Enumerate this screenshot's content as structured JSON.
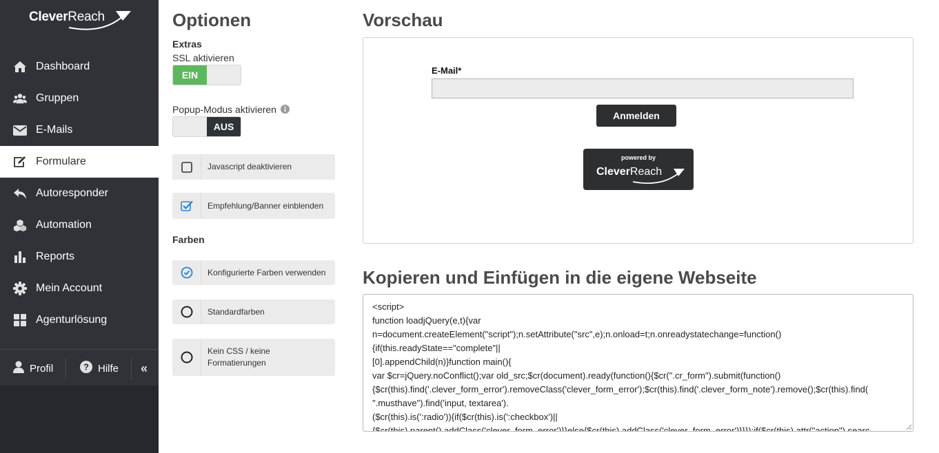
{
  "sidebar": {
    "logo": "CleverReach",
    "logo_bold": "Clever",
    "logo_thin": "Reach",
    "items": [
      {
        "label": "Dashboard",
        "icon": "home-icon"
      },
      {
        "label": "Gruppen",
        "icon": "users-icon"
      },
      {
        "label": "E-Mails",
        "icon": "envelope-icon"
      },
      {
        "label": "Formulare",
        "icon": "edit-icon",
        "active": true
      },
      {
        "label": "Autoresponder",
        "icon": "reply-icon"
      },
      {
        "label": "Automation",
        "icon": "cubes-icon"
      },
      {
        "label": "Reports",
        "icon": "bar-chart-icon"
      },
      {
        "label": "Mein Account",
        "icon": "gear-icon"
      },
      {
        "label": "Agenturlösung",
        "icon": "grid-icon"
      }
    ],
    "profile_label": "Profil",
    "help_label": "Hilfe",
    "collapse_glyph": "«"
  },
  "options": {
    "title": "Optionen",
    "extras_heading": "Extras",
    "ssl_label": "SSL aktivieren",
    "ssl_toggle": {
      "on_label": "EIN",
      "state": "on"
    },
    "popup_label": "Popup-Modus aktivieren",
    "popup_toggle": {
      "off_label": "AUS",
      "state": "off"
    },
    "checkboxes": [
      {
        "label": "Javascript deaktivieren",
        "checked": false
      },
      {
        "label": "Empfehlung/Banner einblenden",
        "checked": true
      }
    ],
    "colors_heading": "Farben",
    "radios": [
      {
        "label": "Konfigurierte Farben verwenden",
        "selected": true
      },
      {
        "label": "Standardfarben",
        "selected": false
      },
      {
        "label_line1": "Kein CSS / keine",
        "label_line2": "Formatierungen",
        "selected": false
      }
    ]
  },
  "preview": {
    "title": "Vorschau",
    "email_label": "E-Mail*",
    "submit_label": "Anmelden",
    "powered_by": "powered by",
    "badge_bold": "Clever",
    "badge_thin": "Reach"
  },
  "embed": {
    "title": "Kopieren und Einfügen in die eigene Webseite",
    "code_lines": [
      "<script>",
      "function loadjQuery(e,t){var",
      "n=document.createElement(\"script\");n.setAttribute(\"src\",e);n.onload=t;n.onreadystatechange=function()",
      "{if(this.readyState==\"complete\"||",
      "[0].appendChild(n)}function main(){",
      "var $cr=jQuery.noConflict();var old_src;$cr(document).ready(function(){$cr(\".cr_form\").submit(function()",
      "{$cr(this).find('.clever_form_error').removeClass('clever_form_error');$cr(this).find('.clever_form_note').remove();$cr(this).find(",
      "\".musthave\").find('input, textarea').",
      "($cr(this).is(':radio')){if($cr(this).is(':checkbox')||",
      "{$cr(this).parent().addClass('clever_form_error')}}else{$cr(this).addClass('clever_form_error')}}});if($cr(this).attr(\"action\").searc"
    ]
  },
  "colors": {
    "sidebar_bg": "#2f3338",
    "toggle_on": "#5cb85c",
    "accent_blue": "#2a85d6"
  }
}
